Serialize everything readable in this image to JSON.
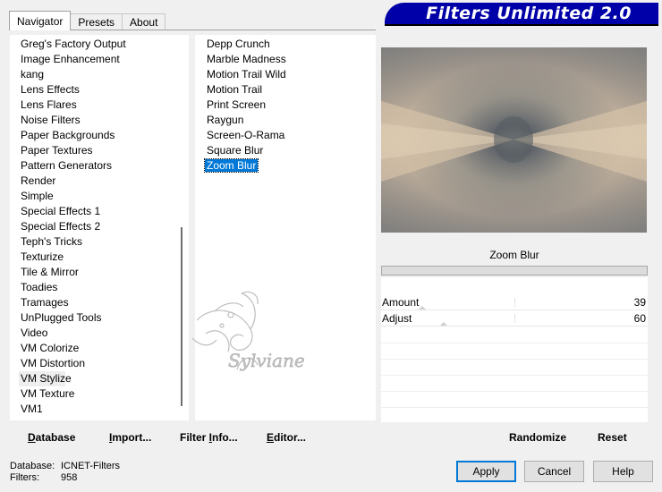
{
  "tabs": [
    {
      "label": "Navigator",
      "active": true
    },
    {
      "label": "Presets",
      "active": false
    },
    {
      "label": "About",
      "active": false
    }
  ],
  "banner": {
    "title": "Filters Unlimited 2.0"
  },
  "categories": [
    "Greg's Factory Output",
    "Image Enhancement",
    "kang",
    "Lens Effects",
    "Lens Flares",
    "Noise Filters",
    "Paper Backgrounds",
    "Paper Textures",
    "Pattern Generators",
    "Render",
    "Simple",
    "Special Effects 1",
    "Special Effects 2",
    "Teph's Tricks",
    "Texturize",
    "Tile & Mirror",
    "Toadies",
    "Tramages",
    "UnPlugged Tools",
    "Video",
    "VM Colorize",
    "VM Distortion",
    "VM Stylize",
    "VM Texture",
    "VM1"
  ],
  "selected_category": "VM Stylize",
  "filters": [
    "Depp Crunch",
    "Marble Madness",
    "Motion Trail Wild",
    "Motion Trail",
    "Print Screen",
    "Raygun",
    "Screen-O-Rama",
    "Square Blur",
    "Zoom Blur"
  ],
  "selected_filter": "Zoom Blur",
  "watermark": {
    "text": "Sylviane"
  },
  "params": {
    "title": "Zoom Blur",
    "items": [
      {
        "label": "Amount",
        "value": "39",
        "level": 39
      },
      {
        "label": "Adjust",
        "value": "60",
        "level": 60
      }
    ]
  },
  "toolbar": {
    "database": {
      "pre": "",
      "u": "D",
      "post": "atabase"
    },
    "import": {
      "pre": "",
      "u": "I",
      "post": "mport..."
    },
    "filter_info": {
      "pre": "Filter ",
      "u": "I",
      "post": "nfo..."
    },
    "editor": {
      "pre": "",
      "u": "E",
      "post": "ditor..."
    },
    "randomize": "Randomize",
    "reset": "Reset"
  },
  "status": {
    "database_label": "Database:",
    "database_value": "ICNET-Filters",
    "filters_label": "Filters:",
    "filters_value": "958"
  },
  "buttons": {
    "apply": "Apply",
    "cancel": "Cancel",
    "help": "Help"
  },
  "colors": {
    "banner": "#0000a8",
    "selection": "#0078d7",
    "preview_light": "#cbb8a1",
    "preview_dark": "#5a6066"
  }
}
